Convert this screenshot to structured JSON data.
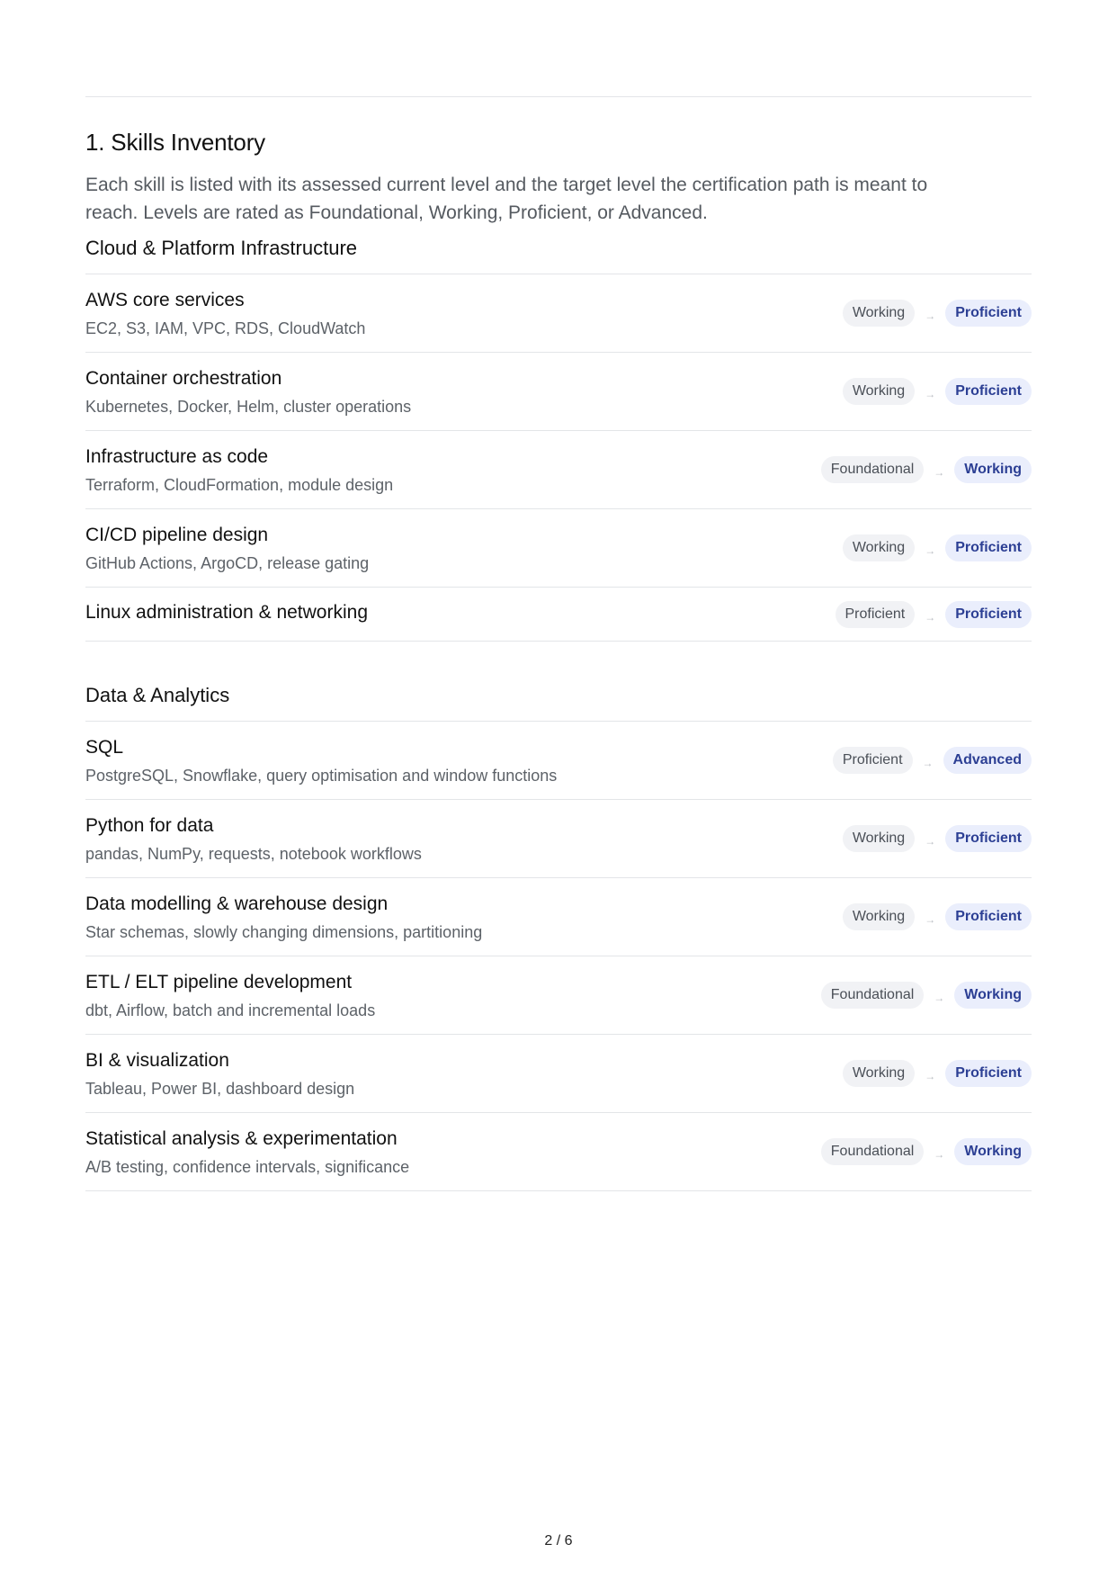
{
  "section": {
    "title": "1. Skills Inventory",
    "intro": "Each skill is listed with its assessed current level and the target level the certification path is meant to reach. Levels are rated as Foundational, Working, Proficient, or Advanced."
  },
  "arrow_glyph": "→",
  "groups": [
    {
      "title": "Cloud & Platform Infrastructure",
      "skills": [
        {
          "name": "AWS core services",
          "desc": "EC2, S3, IAM, VPC, RDS, CloudWatch",
          "current": "Working",
          "target": "Proficient"
        },
        {
          "name": "Container orchestration",
          "desc": "Kubernetes, Docker, Helm, cluster operations",
          "current": "Working",
          "target": "Proficient"
        },
        {
          "name": "Infrastructure as code",
          "desc": "Terraform, CloudFormation, module design",
          "current": "Foundational",
          "target": "Working"
        },
        {
          "name": "CI/CD pipeline design",
          "desc": "GitHub Actions, ArgoCD, release gating",
          "current": "Working",
          "target": "Proficient"
        },
        {
          "name": "Linux administration & networking",
          "desc": "",
          "current": "Proficient",
          "target": "Proficient"
        }
      ]
    },
    {
      "title": "Data & Analytics",
      "skills": [
        {
          "name": "SQL",
          "desc": "PostgreSQL, Snowflake, query optimisation and window functions",
          "current": "Proficient",
          "target": "Advanced"
        },
        {
          "name": "Python for data",
          "desc": "pandas, NumPy, requests, notebook workflows",
          "current": "Working",
          "target": "Proficient"
        },
        {
          "name": "Data modelling & warehouse design",
          "desc": "Star schemas, slowly changing dimensions, partitioning",
          "current": "Working",
          "target": "Proficient"
        },
        {
          "name": "ETL / ELT pipeline development",
          "desc": "dbt, Airflow, batch and incremental loads",
          "current": "Foundational",
          "target": "Working"
        },
        {
          "name": "BI & visualization",
          "desc": "Tableau, Power BI, dashboard design",
          "current": "Working",
          "target": "Proficient"
        },
        {
          "name": "Statistical analysis & experimentation",
          "desc": "A/B testing, confidence intervals, significance",
          "current": "Foundational",
          "target": "Working"
        }
      ]
    }
  ],
  "footer": {
    "page_number": "2 / 6"
  }
}
